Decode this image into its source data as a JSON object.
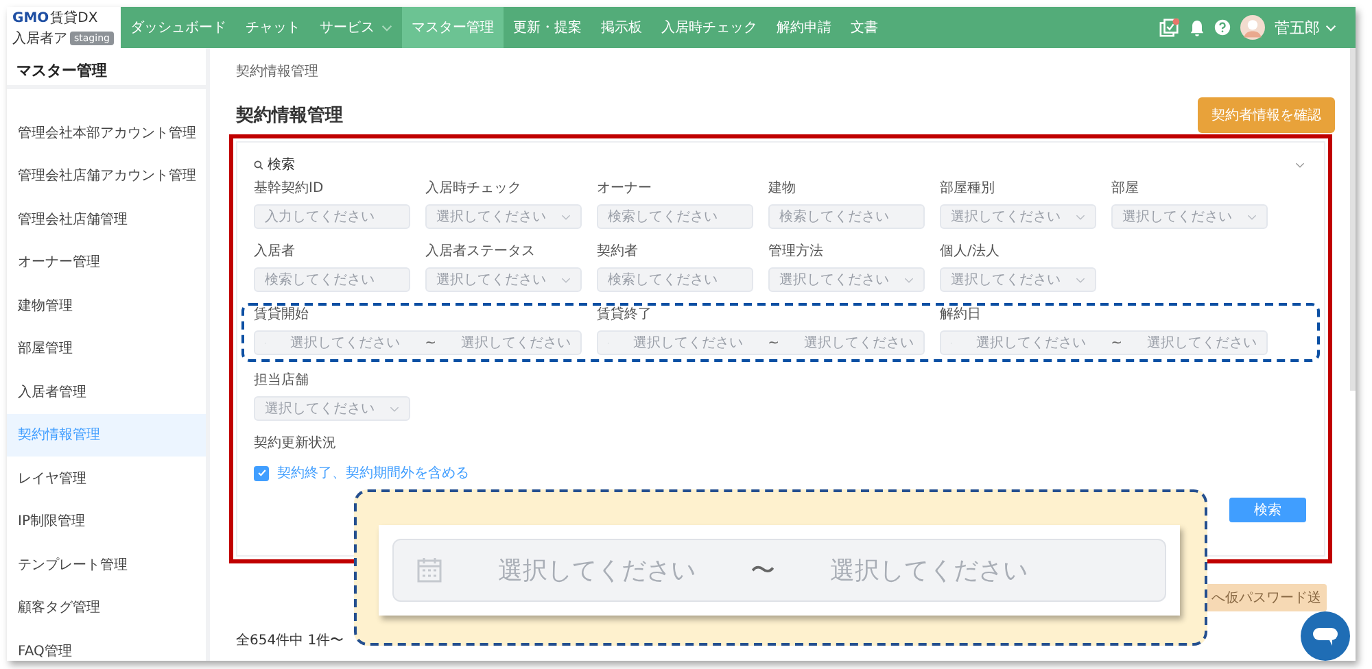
{
  "header": {
    "logo": {
      "brand": "GMO",
      "product": "賃貸DX",
      "subtitle": "入居者ア",
      "badge": "staging"
    },
    "nav": [
      {
        "label": "ダッシュボード",
        "selected": false,
        "dropdown": false
      },
      {
        "label": "チャット",
        "selected": false,
        "dropdown": false
      },
      {
        "label": "サービス",
        "selected": false,
        "dropdown": true
      },
      {
        "label": "マスター管理",
        "selected": true,
        "dropdown": false
      },
      {
        "label": "更新・提案",
        "selected": false,
        "dropdown": false
      },
      {
        "label": "掲示板",
        "selected": false,
        "dropdown": false
      },
      {
        "label": "入居時チェック",
        "selected": false,
        "dropdown": false
      },
      {
        "label": "解約申請",
        "selected": false,
        "dropdown": false
      },
      {
        "label": "文書",
        "selected": false,
        "dropdown": false
      }
    ],
    "tasks_alert": true,
    "user": {
      "name": "菅五郎"
    }
  },
  "sidebar": {
    "title": "マスター管理",
    "items": [
      {
        "label": "管理会社本部アカウント管理",
        "selected": false
      },
      {
        "label": "管理会社店舗アカウント管理",
        "selected": false
      },
      {
        "label": "管理会社店舗管理",
        "selected": false
      },
      {
        "label": "オーナー管理",
        "selected": false
      },
      {
        "label": "建物管理",
        "selected": false
      },
      {
        "label": "部屋管理",
        "selected": false
      },
      {
        "label": "入居者管理",
        "selected": false
      },
      {
        "label": "契約情報管理",
        "selected": true
      },
      {
        "label": "レイヤ管理",
        "selected": false
      },
      {
        "label": "IP制限管理",
        "selected": false
      },
      {
        "label": "テンプレート管理",
        "selected": false
      },
      {
        "label": "顧客タグ管理",
        "selected": false
      },
      {
        "label": "FAQ管理",
        "selected": false
      }
    ]
  },
  "breadcrumb": "契約情報管理",
  "page_title": "契約情報管理",
  "confirm_button": "契約者情報を確認",
  "search_panel": {
    "title": "検索",
    "rows": [
      {
        "highlighted": false,
        "fields": [
          {
            "label": "基幹契約ID",
            "kind": "input",
            "placeholder": "入力してください"
          },
          {
            "label": "入居時チェック",
            "kind": "select",
            "placeholder": "選択してください"
          },
          {
            "label": "オーナー",
            "kind": "input",
            "placeholder": "検索してください"
          },
          {
            "label": "建物",
            "kind": "input",
            "placeholder": "検索してください"
          },
          {
            "label": "部屋種別",
            "kind": "select",
            "placeholder": "選択してください"
          },
          {
            "label": "部屋",
            "kind": "select",
            "placeholder": "選択してください"
          }
        ]
      },
      {
        "highlighted": false,
        "fields": [
          {
            "label": "入居者",
            "kind": "input",
            "placeholder": "検索してください"
          },
          {
            "label": "入居者ステータス",
            "kind": "select",
            "placeholder": "選択してください"
          },
          {
            "label": "契約者",
            "kind": "input",
            "placeholder": "検索してください"
          },
          {
            "label": "管理方法",
            "kind": "select",
            "placeholder": "選択してください"
          },
          {
            "label": "個人/法人",
            "kind": "select",
            "placeholder": "選択してください"
          }
        ]
      },
      {
        "highlighted": true,
        "fields": [
          {
            "label": "賃貸開始",
            "kind": "daterange",
            "start_placeholder": "選択してください",
            "separator": "~",
            "end_placeholder": "選択してください"
          },
          {
            "label": "賃貸終了",
            "kind": "daterange",
            "start_placeholder": "選択してください",
            "separator": "~",
            "end_placeholder": "選択してください"
          },
          {
            "label": "解約日",
            "kind": "daterange",
            "start_placeholder": "選択してください",
            "separator": "~",
            "end_placeholder": "選択してください"
          }
        ]
      },
      {
        "highlighted": false,
        "fields": [
          {
            "label": "担当店舗",
            "kind": "select",
            "placeholder": "選択してください"
          }
        ]
      }
    ],
    "renewal": {
      "label": "契約更新状況",
      "option": "契約終了、契約期間外を含める",
      "checked": true
    },
    "search_button": "検索"
  },
  "password_button": "へ仮パスワード送",
  "result_count": "全654件中 1件〜",
  "callout": {
    "start_placeholder": "選択してください",
    "separator": "〜",
    "end_placeholder": "選択してください"
  }
}
